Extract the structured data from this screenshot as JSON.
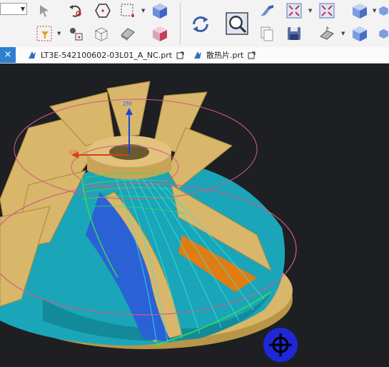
{
  "toolbar": {
    "icons": [
      "filter-arrow-icon",
      "rotate-view-icon",
      "hexagon-point-icon",
      "box-select-icon",
      "cube-view-icon",
      "filter-type-icon",
      "snap-grid-icon",
      "wireframe-cube-icon",
      "eraser-icon",
      "shaded-cube-icon",
      "refresh-icon",
      "zoom-window-icon",
      "plane-icon",
      "fit-view-icon",
      "fit-all-icon",
      "solid-cube-icon",
      "part-navigator-icon",
      "save-icon",
      "face-snap-icon",
      "view-cube-icon"
    ]
  },
  "tabs": [
    {
      "label": "LT3E-542100602-03L01_A_NC.prt"
    },
    {
      "label": "散热片.prt"
    }
  ],
  "viewport": {
    "axis_z": "ZM",
    "axis_x": "XM",
    "background": "#1e1f23"
  },
  "colors": {
    "blade": "#d8b66a",
    "hub": "#1aa6b8",
    "toolpath_green": "#39e04a",
    "toolpath_cyan": "#2fe6e6",
    "accent": "#2f7fd1"
  }
}
